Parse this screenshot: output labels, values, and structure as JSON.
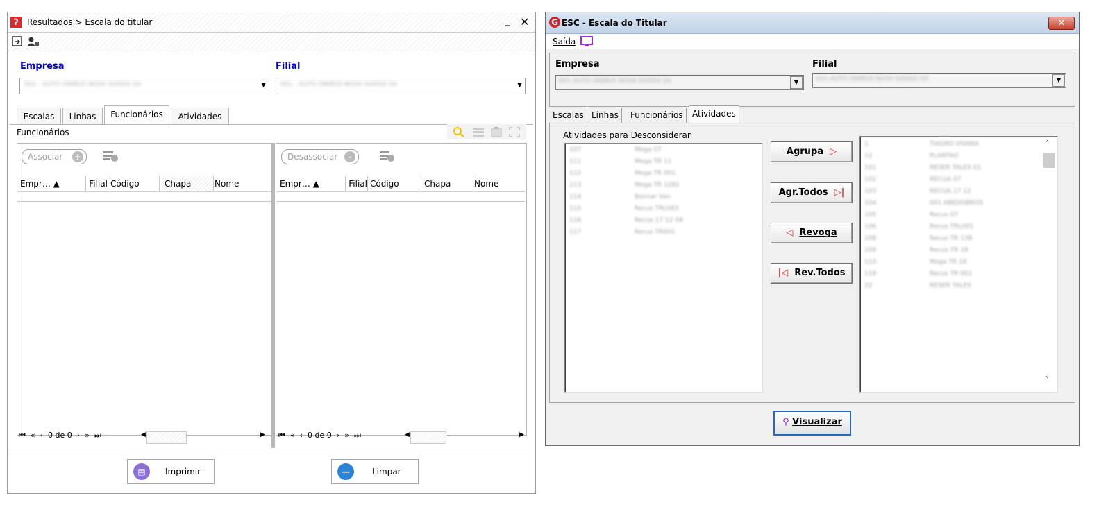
{
  "left_window": {
    "title": "Resultados > Escala do titular",
    "minimize_glyph": "_",
    "close_glyph": "✕",
    "empresa_label": "Empresa",
    "filial_label": "Filial",
    "empresa_value": "001 - AUTO ONIBUS NOVA SUISSA SA",
    "filial_value": "001 - AUTO ONIBUS NOVA SUISSA SA",
    "tabs": [
      "Escalas",
      "Linhas",
      "Funcionários",
      "Atividades"
    ],
    "active_tab": "Funcionários",
    "panel_title": "Funcionários",
    "associar_label": "Associar",
    "desassociar_label": "Desassociar",
    "columns": [
      "Empr… ▲",
      "Filial",
      "Código",
      "Chapa",
      "Nome"
    ],
    "pager_text": "0 de 0",
    "imprimir_label": "Imprimir",
    "limpar_label": "Limpar"
  },
  "right_window": {
    "title": "ESC - Escala do Titular",
    "close_glyph": "✕",
    "menu_saida": "Saída",
    "empresa_label": "Empresa",
    "filial_label": "Filial",
    "empresa_value": "001 AUTO ONIBUS NOVA SUISSA SA",
    "filial_value": "001 AUTO ONIBUS NOVA SUISSA SA",
    "tabs": [
      "Escalas",
      "Linhas",
      "Funcionários",
      "Atividades"
    ],
    "active_tab": "Atividades",
    "group_label": "Atividades para Desconsiderar",
    "left_list": [
      [
        "107",
        "Mega 07"
      ],
      [
        "111",
        "Mega TR 11"
      ],
      [
        "112",
        "Mega TR 001"
      ],
      [
        "113",
        "Mega TR 1281"
      ],
      [
        "114",
        "Bonnar Van"
      ],
      [
        "115",
        "Recus TRL083"
      ],
      [
        "116",
        "Recus 17 12 09"
      ],
      [
        "117",
        "Recus TR001"
      ]
    ],
    "right_list": [
      [
        "1",
        "TIAGRO VIVANA"
      ],
      [
        "12",
        "PLANTAO"
      ],
      [
        "101",
        "RESER TALES 01"
      ],
      [
        "102",
        "RECUA 07"
      ],
      [
        "103",
        "RECUA 17 12"
      ],
      [
        "104",
        "001 ABEDOBROS"
      ],
      [
        "105",
        "Recus 07"
      ],
      [
        "106",
        "Recus TRL001"
      ],
      [
        "108",
        "Recus TR 138"
      ],
      [
        "109",
        "Recus TR 18"
      ],
      [
        "110",
        "Mega TR 18"
      ],
      [
        "118",
        "Recus TR 001"
      ],
      [
        "22",
        "RESER TALES"
      ]
    ],
    "agrupa_label": "Agrupa",
    "agr_todos_label": "Agr.Todos",
    "revoga_label": "Revoga",
    "rev_todos_label": "Rev.Todos",
    "visualizar_label": "Visualizar"
  }
}
